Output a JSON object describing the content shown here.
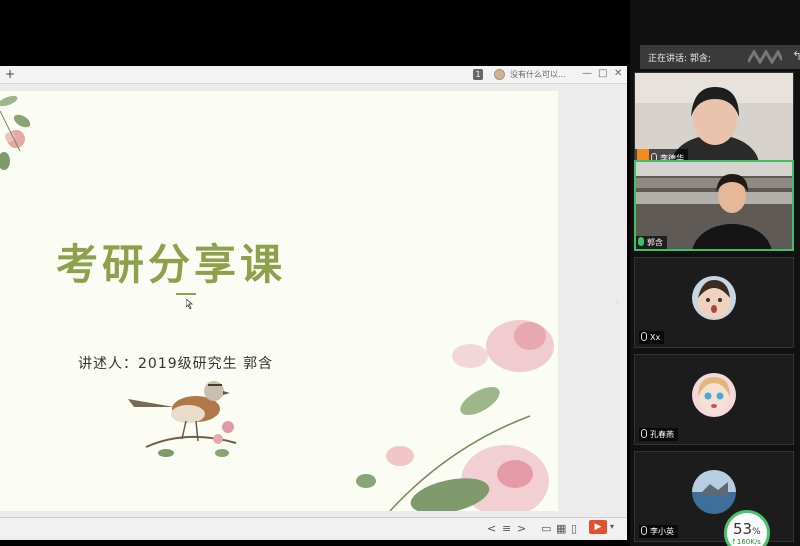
{
  "share_window": {
    "topbar": {
      "plus": "+",
      "badge": "1",
      "note": "没有什么可以...",
      "min": "—",
      "max": "□",
      "close": "✕"
    },
    "slide": {
      "title": "考研分享课",
      "speaker": "讲述人：2019级研究生   郭含"
    },
    "bottombar": {
      "prev": "<",
      "list": "≡",
      "next": ">",
      "view1": "▭",
      "view2": "▦",
      "view3": "▯",
      "play": "▶",
      "more": "▾"
    }
  },
  "panel": {
    "speaking_label": "正在讲话: 郭含;",
    "back_icon": "↰",
    "participants": [
      {
        "name": "李德华",
        "host": true,
        "mic_on": false
      },
      {
        "name": "郭含",
        "host": false,
        "mic_on": true,
        "active": true
      },
      {
        "name": "Xx",
        "host": false,
        "mic_on": false
      },
      {
        "name": "孔春燕",
        "host": false,
        "mic_on": false
      },
      {
        "name": "李小英",
        "host": false,
        "mic_on": false
      }
    ],
    "network": {
      "percent": "53",
      "percent_sign": "%",
      "speed": "↑160K/s"
    }
  },
  "colors": {
    "accent": "#3fbf6a",
    "title_green": "#8ea04a",
    "host_orange": "#f28a1e"
  }
}
